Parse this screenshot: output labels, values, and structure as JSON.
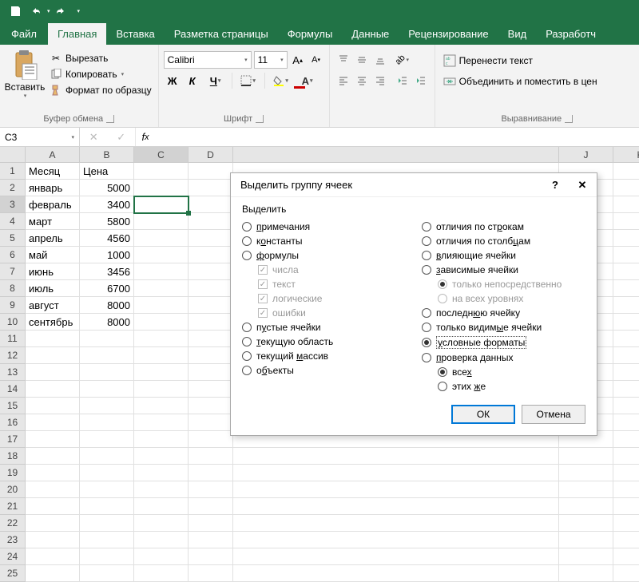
{
  "titlebar": {
    "save_tt": "Сохранить",
    "undo_tt": "Отменить",
    "redo_tt": "Повторить"
  },
  "tabs": {
    "file": "Файл",
    "home": "Главная",
    "insert": "Вставка",
    "layout": "Разметка страницы",
    "formulas": "Формулы",
    "data": "Данные",
    "review": "Рецензирование",
    "view": "Вид",
    "developer": "Разработч"
  },
  "ribbon": {
    "paste": "Вставить",
    "cut": "Вырезать",
    "copy": "Копировать",
    "format_painter": "Формат по образцу",
    "clipboard_label": "Буфер обмена",
    "font_name": "Calibri",
    "font_size": "11",
    "bold": "Ж",
    "italic": "К",
    "underline": "Ч",
    "font_label": "Шрифт",
    "wrap_text": "Перенести текст",
    "merge_center": "Объединить и поместить в цен",
    "align_label": "Выравнивание"
  },
  "namebox": "C3",
  "columns": [
    "A",
    "B",
    "C",
    "D",
    "J",
    "K"
  ],
  "sheet": {
    "headers": {
      "a1": "Месяц",
      "b1": "Цена"
    },
    "rows": [
      {
        "month": "январь",
        "price": "5000"
      },
      {
        "month": "февраль",
        "price": "3400"
      },
      {
        "month": "март",
        "price": "5800"
      },
      {
        "month": "апрель",
        "price": "4560"
      },
      {
        "month": "май",
        "price": "1000"
      },
      {
        "month": "июнь",
        "price": "3456"
      },
      {
        "month": "июль",
        "price": "6700"
      },
      {
        "month": "август",
        "price": "8000"
      },
      {
        "month": "сентябрь",
        "price": "8000"
      }
    ]
  },
  "dialog": {
    "title": "Выделить группу ячеек",
    "heading": "Выделить",
    "left": {
      "comments": "примечания",
      "constants": "константы",
      "formulas": "формулы",
      "numbers": "числа",
      "text": "текст",
      "logical": "логические",
      "errors": "ошибки",
      "blanks": "пустые ячейки",
      "current_region": "текущую область",
      "current_array": "текущий массив",
      "objects": "объекты"
    },
    "right": {
      "row_diff": "отличия по строкам",
      "col_diff": "отличия по столбцам",
      "precedents": "влияющие ячейки",
      "dependents": "зависимые ячейки",
      "direct_only": "только непосредственно",
      "all_levels": "на всех уровнях",
      "last_cell": "последнюю ячейку",
      "visible_only": "только видимые ячейки",
      "cond_formats": "условные форматы",
      "data_validation": "проверка данных",
      "all": "всех",
      "same": "этих же"
    },
    "ok": "ОК",
    "cancel": "Отмена"
  }
}
